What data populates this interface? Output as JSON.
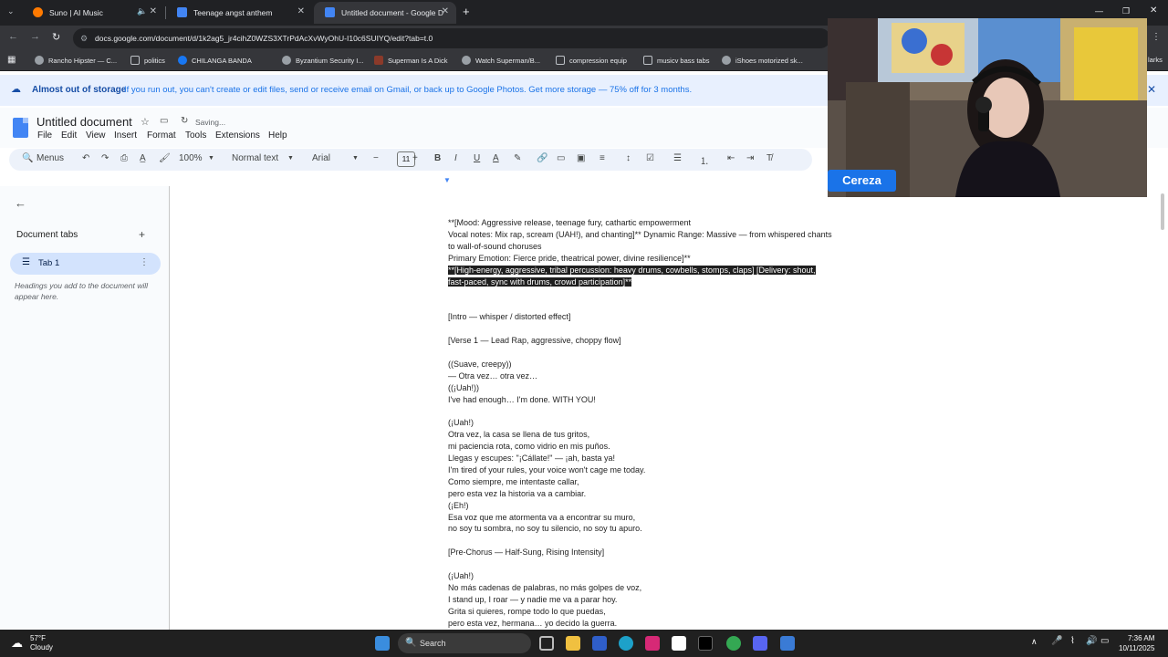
{
  "browser": {
    "tabs": [
      {
        "title": "Suno | AI Music",
        "color": "#ff7a00"
      },
      {
        "title": "Teenage angst anthem",
        "color": "#4285f4"
      },
      {
        "title": "Untitled document - Google D",
        "color": "#4285f4"
      }
    ],
    "url": "docs.google.com/document/d/1k2ag5_jr4cihZ0WZS3XTrPdAcXvWyOhU-I10c6SUIYQ/edit?tab=t.0",
    "bookmarks": [
      "Rancho Hipster — C...",
      "politics",
      "CHILANGA BANDA",
      "Byzantium Security I...",
      "Superman Is A Dick",
      "Watch Superman/B...",
      "compression equip",
      "musicv bass tabs",
      "iShoes motorized sk...",
      "larks"
    ]
  },
  "banner": {
    "title": "Almost out of storage",
    "message": "If you run out, you can't create or edit files, send or receive email on Gmail, or back up to Google Photos. Get more storage — 75% off for 3 months."
  },
  "docs": {
    "title": "Untitled document",
    "status": "Saving...",
    "menu": [
      "File",
      "Edit",
      "View",
      "Insert",
      "Format",
      "Tools",
      "Extensions",
      "Help"
    ],
    "toolbar": {
      "menus": "Menus",
      "zoom": "100%",
      "style": "Normal text",
      "font": "Arial",
      "font_size": "11"
    },
    "side": {
      "doc_tabs_label": "Document tabs",
      "tab1": "Tab 1",
      "hint": "Headings you add to the document will appear here."
    },
    "lines": [
      "**[Mood: Aggressive release, teenage fury, cathartic empowerment",
      "Vocal notes: Mix rap, scream (UAH!), and chanting]** Dynamic Range: Massive — from whispered chants",
      "to wall-of-sound choruses",
      "Primary Emotion: Fierce pride, theatrical power, divine resilience]**",
      "**[High-energy, aggressive, tribal percussion: heavy drums, cowbells, stomps, claps] [Delivery: shout,",
      "fast-paced, sync with drums, crowd participation]**",
      "",
      "",
      "[Intro — whisper / distorted effect]",
      "",
      "[Verse 1 — Lead Rap, aggressive, choppy flow]",
      "",
      "((Suave, creepy))",
      "— Otra vez… otra vez…",
      "((¡Uah!))",
      "I've had enough… I'm done. WITH YOU!",
      "",
      "(¡Uah!)",
      "Otra vez, la casa se llena de tus gritos,",
      "mi paciencia rota, como vidrio en mis puños.",
      "Llegas y escupes: \"¡Cállate!\" — ¡ah, basta ya!",
      "I'm tired of your rules, your voice won't cage me today.",
      "Como siempre, me intentaste callar,",
      "pero esta vez la historia va a cambiar.",
      "(¡Eh!)",
      "Esa voz que me atormenta va a encontrar su muro,",
      "no soy tu sombra, no soy tu silencio, no soy tu apuro.",
      "",
      "[Pre-Chorus — Half-Sung, Rising Intensity]",
      "",
      "(¡Uah!)",
      "No más cadenas de palabras, no más golpes de voz,",
      "I stand up, I roar — y nadie me va a parar hoy.",
      "Grita si quieres, rompe todo lo que puedas,",
      "pero esta vez, hermana… yo decido la guerra."
    ]
  },
  "webcam": {
    "name": "Cereza"
  },
  "taskbar": {
    "weather_temp": "57°F",
    "weather_desc": "Cloudy",
    "search": "Search",
    "time": "7:36 AM",
    "date": "10/11/2025"
  }
}
